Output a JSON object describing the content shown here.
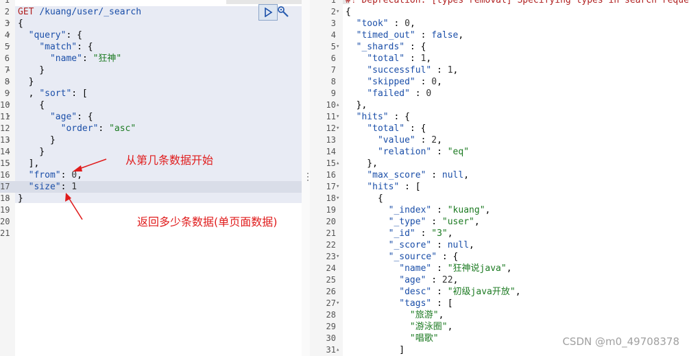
{
  "request": {
    "start_line": 1,
    "lines": [
      {
        "num": "1",
        "fold": "",
        "html": ""
      },
      {
        "num": "2",
        "fold": "",
        "html": "<span class='m'>GET</span> <span class='k'>/kuang/user/_search</span>"
      },
      {
        "num": "3",
        "fold": "▾",
        "html": "{"
      },
      {
        "num": "4",
        "fold": "▾",
        "html": "  <span class='k'>\"query\"</span>: {"
      },
      {
        "num": "5",
        "fold": "▾",
        "html": "    <span class='k'>\"match\"</span>: {"
      },
      {
        "num": "6",
        "fold": "",
        "html": "      <span class='k'>\"name\"</span>: <span class='s'>\"狂神\"</span>"
      },
      {
        "num": "7",
        "fold": "▴",
        "html": "    }"
      },
      {
        "num": "8",
        "fold": "▴",
        "html": "  }"
      },
      {
        "num": "9",
        "fold": "▾",
        "html": "  , <span class='k'>\"sort\"</span>: ["
      },
      {
        "num": "10",
        "fold": "▾",
        "html": "    {"
      },
      {
        "num": "11",
        "fold": "▾",
        "html": "      <span class='k'>\"age\"</span>: {"
      },
      {
        "num": "12",
        "fold": "",
        "html": "        <span class='k'>\"order\"</span>: <span class='s'>\"asc\"</span>"
      },
      {
        "num": "13",
        "fold": "▴",
        "html": "      }"
      },
      {
        "num": "14",
        "fold": "▴",
        "html": "    }"
      },
      {
        "num": "15",
        "fold": "▴",
        "html": "  ],"
      },
      {
        "num": "16",
        "fold": "",
        "html": "  <span class='k'>\"from\"</span>: <span class='n'>0</span>,"
      },
      {
        "num": "17",
        "fold": "",
        "html": "  <span class='k'>\"size\"</span>: <span class='n'>1</span>"
      },
      {
        "num": "18",
        "fold": "▴",
        "html": "}"
      },
      {
        "num": "19",
        "fold": "",
        "html": ""
      },
      {
        "num": "20",
        "fold": "",
        "html": ""
      },
      {
        "num": "21",
        "fold": "",
        "html": ""
      }
    ]
  },
  "response": {
    "lines": [
      {
        "num": "1",
        "fold": "",
        "html": "<span class='m'>#! Deprecation: [types removal] Specifying types in search requests</span>"
      },
      {
        "num": "2",
        "fold": "▾",
        "html": "{"
      },
      {
        "num": "3",
        "fold": "",
        "html": "  <span class='k'>\"took\"</span> : <span class='n'>0</span>,"
      },
      {
        "num": "4",
        "fold": "",
        "html": "  <span class='k'>\"timed_out\"</span> : <span class='k'>false</span>,"
      },
      {
        "num": "5",
        "fold": "▾",
        "html": "  <span class='k'>\"_shards\"</span> : {"
      },
      {
        "num": "6",
        "fold": "",
        "html": "    <span class='k'>\"total\"</span> : <span class='n'>1</span>,"
      },
      {
        "num": "7",
        "fold": "",
        "html": "    <span class='k'>\"successful\"</span> : <span class='n'>1</span>,"
      },
      {
        "num": "8",
        "fold": "",
        "html": "    <span class='k'>\"skipped\"</span> : <span class='n'>0</span>,"
      },
      {
        "num": "9",
        "fold": "",
        "html": "    <span class='k'>\"failed\"</span> : <span class='n'>0</span>"
      },
      {
        "num": "10",
        "fold": "▴",
        "html": "  },"
      },
      {
        "num": "11",
        "fold": "▾",
        "html": "  <span class='k'>\"hits\"</span> : {"
      },
      {
        "num": "12",
        "fold": "▾",
        "html": "    <span class='k'>\"total\"</span> : {"
      },
      {
        "num": "13",
        "fold": "",
        "html": "      <span class='k'>\"value\"</span> : <span class='n'>2</span>,"
      },
      {
        "num": "14",
        "fold": "",
        "html": "      <span class='k'>\"relation\"</span> : <span class='s'>\"eq\"</span>"
      },
      {
        "num": "15",
        "fold": "▴",
        "html": "    },"
      },
      {
        "num": "16",
        "fold": "",
        "html": "    <span class='k'>\"max_score\"</span> : <span class='k'>null</span>,"
      },
      {
        "num": "17",
        "fold": "▾",
        "html": "    <span class='k'>\"hits\"</span> : ["
      },
      {
        "num": "18",
        "fold": "▾",
        "html": "      {"
      },
      {
        "num": "19",
        "fold": "",
        "html": "        <span class='k'>\"_index\"</span> : <span class='s'>\"kuang\"</span>,"
      },
      {
        "num": "20",
        "fold": "",
        "html": "        <span class='k'>\"_type\"</span> : <span class='s'>\"user\"</span>,"
      },
      {
        "num": "21",
        "fold": "",
        "html": "        <span class='k'>\"_id\"</span> : <span class='s'>\"3\"</span>,"
      },
      {
        "num": "22",
        "fold": "",
        "html": "        <span class='k'>\"_score\"</span> : <span class='k'>null</span>,"
      },
      {
        "num": "23",
        "fold": "▾",
        "html": "        <span class='k'>\"_source\"</span> : {"
      },
      {
        "num": "24",
        "fold": "",
        "html": "          <span class='k'>\"name\"</span> : <span class='s'>\"狂神说java\"</span>,"
      },
      {
        "num": "25",
        "fold": "",
        "html": "          <span class='k'>\"age\"</span> : <span class='n'>22</span>,"
      },
      {
        "num": "26",
        "fold": "",
        "html": "          <span class='k'>\"desc\"</span> : <span class='s'>\"初级java开放\"</span>,"
      },
      {
        "num": "27",
        "fold": "▾",
        "html": "          <span class='k'>\"tags\"</span> : ["
      },
      {
        "num": "28",
        "fold": "",
        "html": "            <span class='s'>\"旅游\"</span>,"
      },
      {
        "num": "29",
        "fold": "",
        "html": "            <span class='s'>\"游泳圈\"</span>,"
      },
      {
        "num": "30",
        "fold": "",
        "html": "            <span class='s'>\"唱歌\"</span>"
      },
      {
        "num": "31",
        "fold": "▴",
        "html": "          ]"
      }
    ]
  },
  "annotations": {
    "from_note": "从第几条数据开始",
    "size_note": "返回多少条数据(单页面数据)"
  },
  "watermark": "CSDN @m0_49708378",
  "icons": {
    "run": "play-icon",
    "settings": "wrench-icon"
  }
}
